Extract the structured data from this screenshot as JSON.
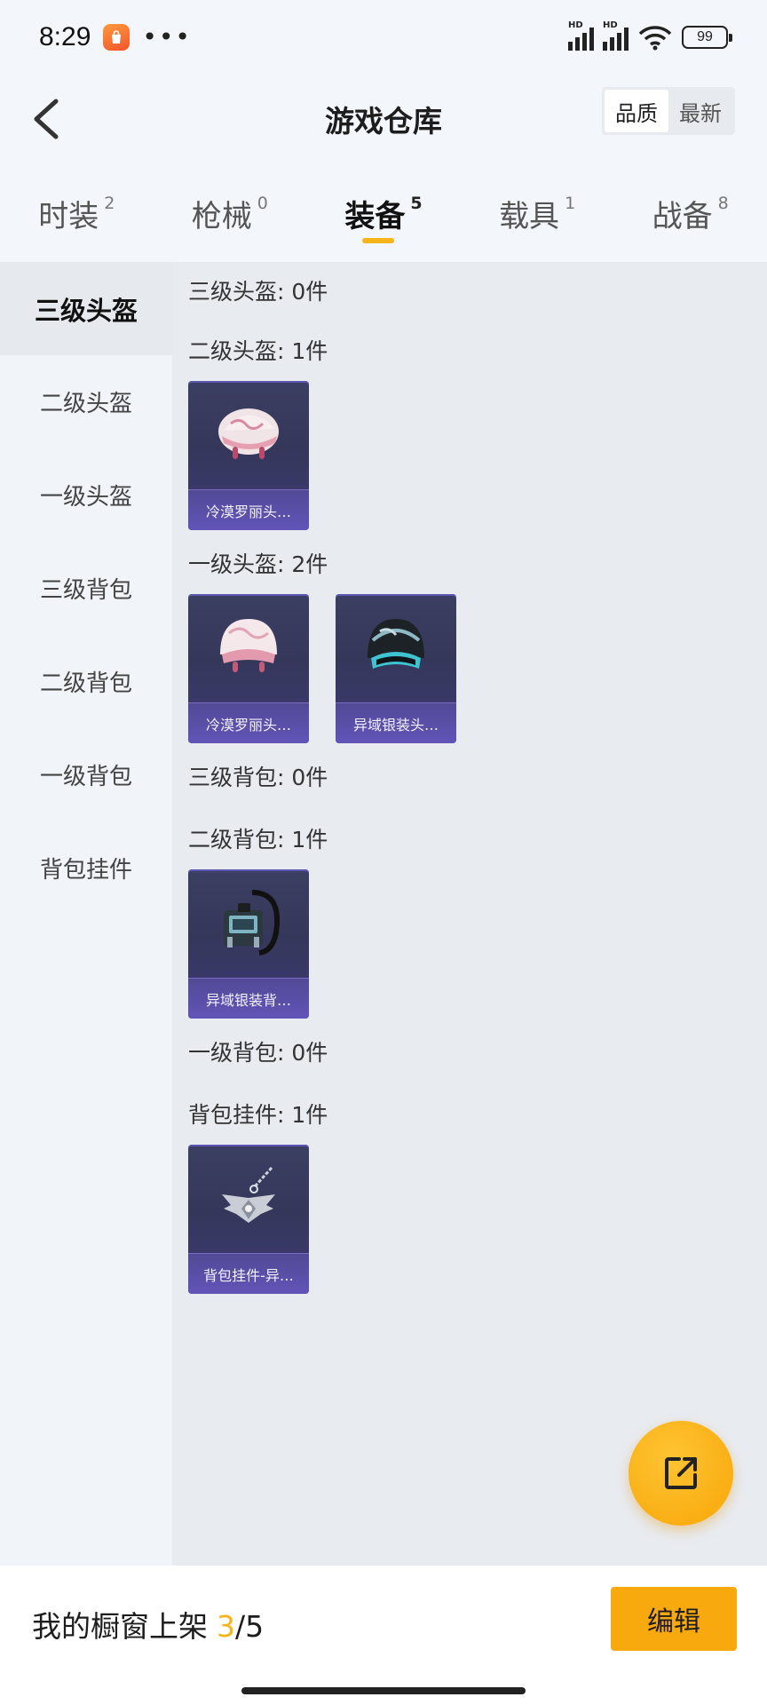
{
  "status_bar": {
    "time": "8:29",
    "dots": "•••",
    "battery": "99",
    "hd_label": "HD",
    "app_icon": "shopping-bag-icon"
  },
  "header": {
    "title": "游戏仓库",
    "sort_options": [
      "品质",
      "最新"
    ],
    "active_sort": "品质"
  },
  "tabs": [
    {
      "label": "时装",
      "count": "2"
    },
    {
      "label": "枪械",
      "count": "0"
    },
    {
      "label": "装备",
      "count": "5",
      "active": true
    },
    {
      "label": "载具",
      "count": "1"
    },
    {
      "label": "战备",
      "count": "8"
    }
  ],
  "sidebar": {
    "items": [
      "三级头盔",
      "二级头盔",
      "一级头盔",
      "三级背包",
      "二级背包",
      "一级背包",
      "背包挂件"
    ],
    "active_index": 0
  },
  "sections": [
    {
      "label": "三级头盔: 0件",
      "items": []
    },
    {
      "label": "二级头盔: 1件",
      "items": [
        {
          "name": "冷漠罗丽头…",
          "icon": "pink-helmet-icon"
        }
      ]
    },
    {
      "label": "一级头盔: 2件",
      "items": [
        {
          "name": "冷漠罗丽头…",
          "icon": "pink-open-helmet-icon"
        },
        {
          "name": "异域银装头…",
          "icon": "black-helmet-icon"
        }
      ]
    },
    {
      "label": "三级背包: 0件",
      "items": []
    },
    {
      "label": "二级背包: 1件",
      "items": [
        {
          "name": "异域银装背…",
          "icon": "backpack-icon"
        }
      ]
    },
    {
      "label": "一级背包: 0件",
      "items": []
    },
    {
      "label": "背包挂件: 1件",
      "items": [
        {
          "name": "背包挂件-异…",
          "icon": "winged-charm-icon"
        }
      ]
    }
  ],
  "fab": {
    "icon": "share-external-icon"
  },
  "bottom_bar": {
    "showcase_label": "我的橱窗上架",
    "showcase_count": "3",
    "showcase_total": "/5",
    "edit_label": "编辑"
  },
  "colors": {
    "accent": "#f5b417",
    "edit_button": "#f7a90e",
    "card_bg": "#3b3f62",
    "card_name_bar": "#6154b8"
  }
}
